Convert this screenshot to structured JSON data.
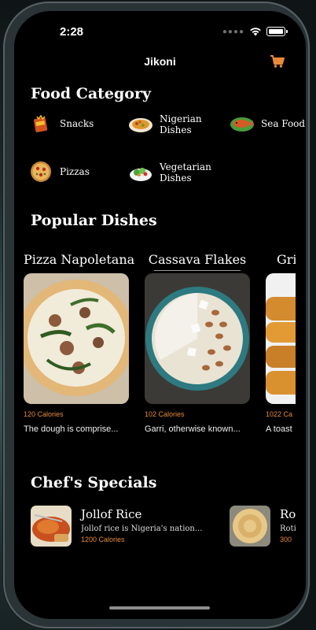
{
  "status": {
    "time": "2:28"
  },
  "nav": {
    "title": "Jikoni",
    "cart_icon": "cart-icon"
  },
  "sections": {
    "categories": "Food Category",
    "popular": "Popular Dishes",
    "specials": "Chef's Specials"
  },
  "categories": [
    {
      "label": "Snacks",
      "icon": "snacks-icon"
    },
    {
      "label": "Nigerian Dishes",
      "icon": "nigerian-dishes-icon"
    },
    {
      "label": "Sea Food",
      "icon": "sea-food-icon"
    },
    {
      "label": "Pizzas",
      "icon": "pizza-icon"
    },
    {
      "label": "Vegetarian Dishes",
      "icon": "vegetarian-icon"
    }
  ],
  "popular_dishes": [
    {
      "name": "Pizza Napoletana",
      "calories": "120 Calories",
      "description": "The dough is comprise..."
    },
    {
      "name": "Cassava Flakes",
      "calories": "102 Calories",
      "description": "Garri, otherwise known..."
    },
    {
      "name": "Gri",
      "calories": "1022 Ca",
      "description": "A toast"
    }
  ],
  "chef_specials": [
    {
      "name": "Jollof Rice",
      "description": "Jollof rice is Nigeria's nation...",
      "calories": "1200 Calories"
    },
    {
      "name": "Ro",
      "description": "Roti",
      "calories": "300"
    }
  ],
  "colors": {
    "accent": "#e88a3a",
    "background": "#000000"
  }
}
